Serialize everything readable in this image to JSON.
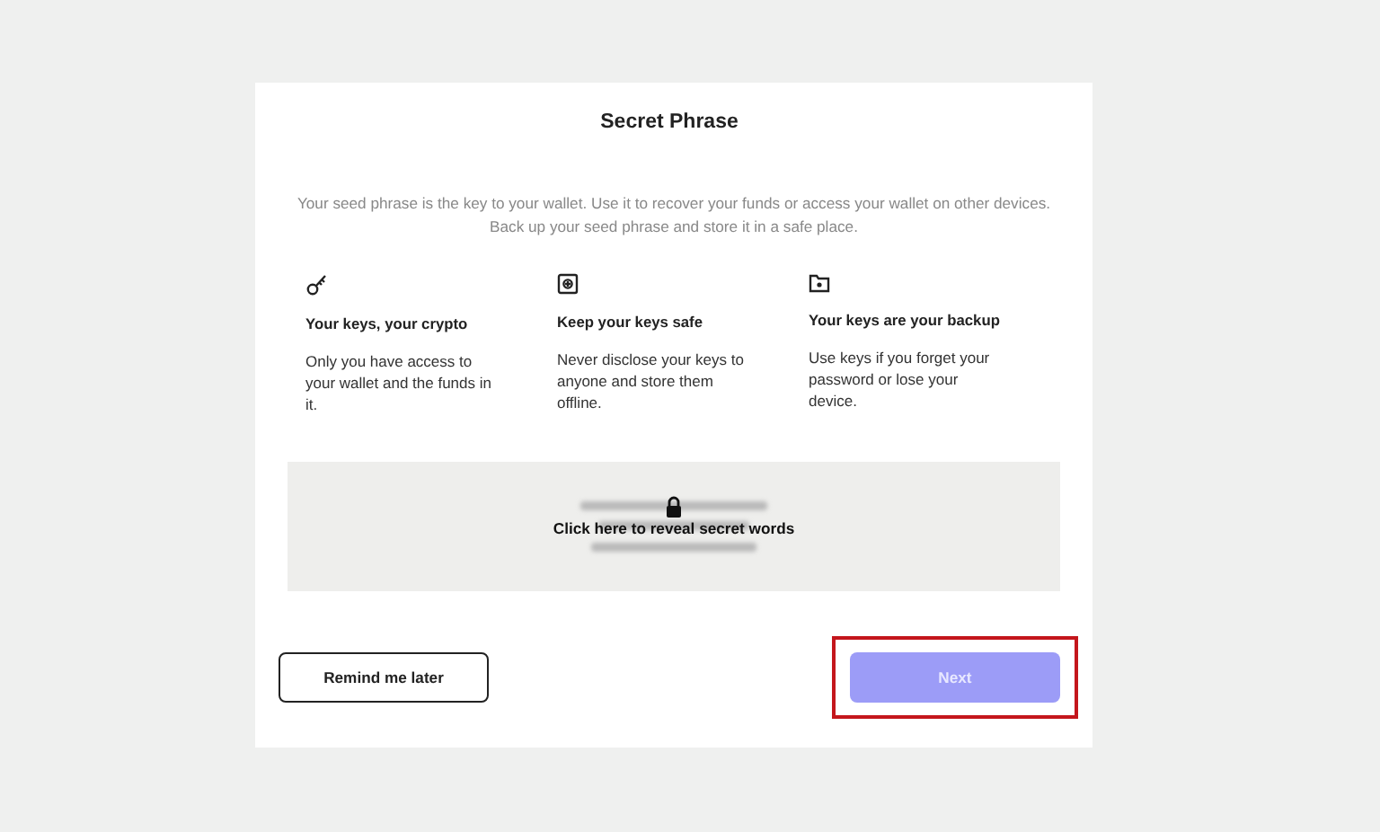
{
  "title": "Secret Phrase",
  "description": "Your seed phrase is the key to your wallet. Use it to recover your funds or access your wallet on other devices. Back up your seed phrase and store it in a safe place.",
  "features": [
    {
      "kind": "key",
      "heading": "Your keys, your crypto",
      "text": "Only you have access to your wallet and the funds in it."
    },
    {
      "kind": "safe",
      "heading": "Keep your keys safe",
      "text": "Never disclose your keys to anyone and store them offline."
    },
    {
      "kind": "folder",
      "heading": "Your keys are your backup",
      "text": "Use keys if you forget your password or lose your device."
    }
  ],
  "reveal": {
    "label": "Click here to reveal secret words"
  },
  "buttons": [
    {
      "kind": "secondary",
      "label": "Remind me later",
      "disabled": false,
      "highlighted": false
    },
    {
      "kind": "primary",
      "label": "Next",
      "disabled": true,
      "highlighted": true
    }
  ]
}
